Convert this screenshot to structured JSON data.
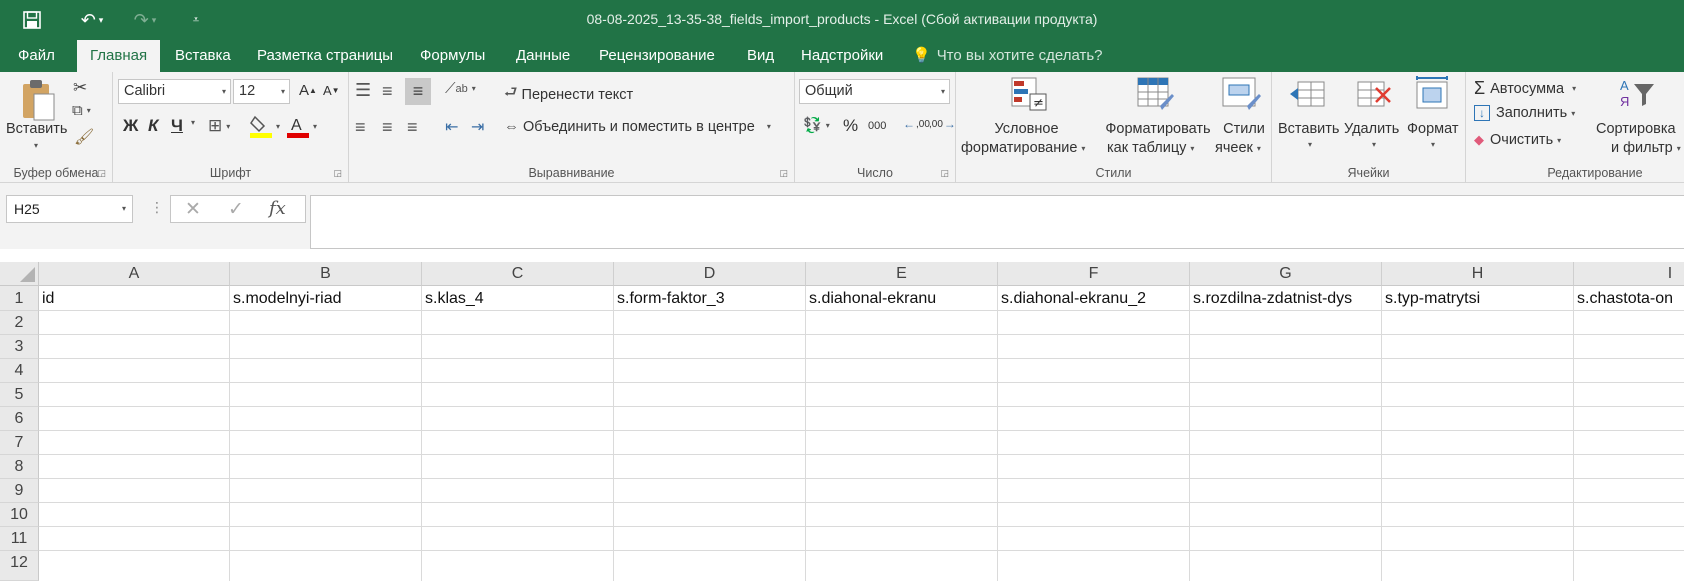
{
  "title_bar": {
    "title": "08-08-2025_13-35-38_fields_import_products - Excel (Сбой активации продукта)"
  },
  "tabs": [
    {
      "label": "Файл",
      "active": false
    },
    {
      "label": "Главная",
      "active": true
    },
    {
      "label": "Вставка",
      "active": false
    },
    {
      "label": "Разметка страницы",
      "active": false
    },
    {
      "label": "Формулы",
      "active": false
    },
    {
      "label": "Данные",
      "active": false
    },
    {
      "label": "Рецензирование",
      "active": false
    },
    {
      "label": "Вид",
      "active": false
    },
    {
      "label": "Надстройки",
      "active": false
    }
  ],
  "tell_me": "Что вы хотите сделать?",
  "ribbon": {
    "clipboard": {
      "label": "Буфер обмена",
      "paste": "Вставить"
    },
    "font": {
      "label": "Шрифт",
      "font_name": "Calibri",
      "font_size": "12",
      "bold": "Ж",
      "italic": "К",
      "underline": "Ч"
    },
    "alignment": {
      "label": "Выравнивание",
      "wrap_text": "Перенести текст",
      "merge_center": "Объединить и поместить в центре"
    },
    "number": {
      "label": "Число",
      "format": "Общий",
      "percent": "%",
      "thousands": "000",
      "inc_decimal": ",00",
      "dec_decimal": ",00"
    },
    "styles": {
      "label": "Стили",
      "conditional_1": "Условное",
      "conditional_2": "форматирование",
      "format_table_1": "Форматировать",
      "format_table_2": "как таблицу",
      "cell_styles_1": "Стили",
      "cell_styles_2": "ячеек"
    },
    "cells": {
      "label": "Ячейки",
      "insert": "Вставить",
      "delete": "Удалить",
      "format": "Формат"
    },
    "editing": {
      "label": "Редактирование",
      "autosum": "Автосумма",
      "fill": "Заполнить",
      "clear": "Очистить",
      "sort_1": "Сортировка",
      "sort_2": "и фильтр"
    }
  },
  "formula_bar": {
    "name_box": "H25",
    "fx": "fx",
    "formula": ""
  },
  "sheet": {
    "columns": [
      "A",
      "B",
      "C",
      "D",
      "E",
      "F",
      "G",
      "H",
      "I"
    ],
    "rows": [
      "1",
      "2",
      "3",
      "4",
      "5",
      "6",
      "7",
      "8",
      "9",
      "10",
      "11",
      "12"
    ],
    "row1": [
      "id",
      "s.modelnyi-riad",
      "s.klas_4",
      "s.form-faktor_3",
      "s.diahonal-ekranu",
      "s.diahonal-ekranu_2",
      "s.rozdilna-zdatnist-dys",
      "s.typ-matrytsi",
      "s.chastota-on"
    ]
  },
  "colors": {
    "brand": "#217346",
    "ribbon_bg": "#f3f3f3",
    "header_bg": "#e9e9e9"
  }
}
